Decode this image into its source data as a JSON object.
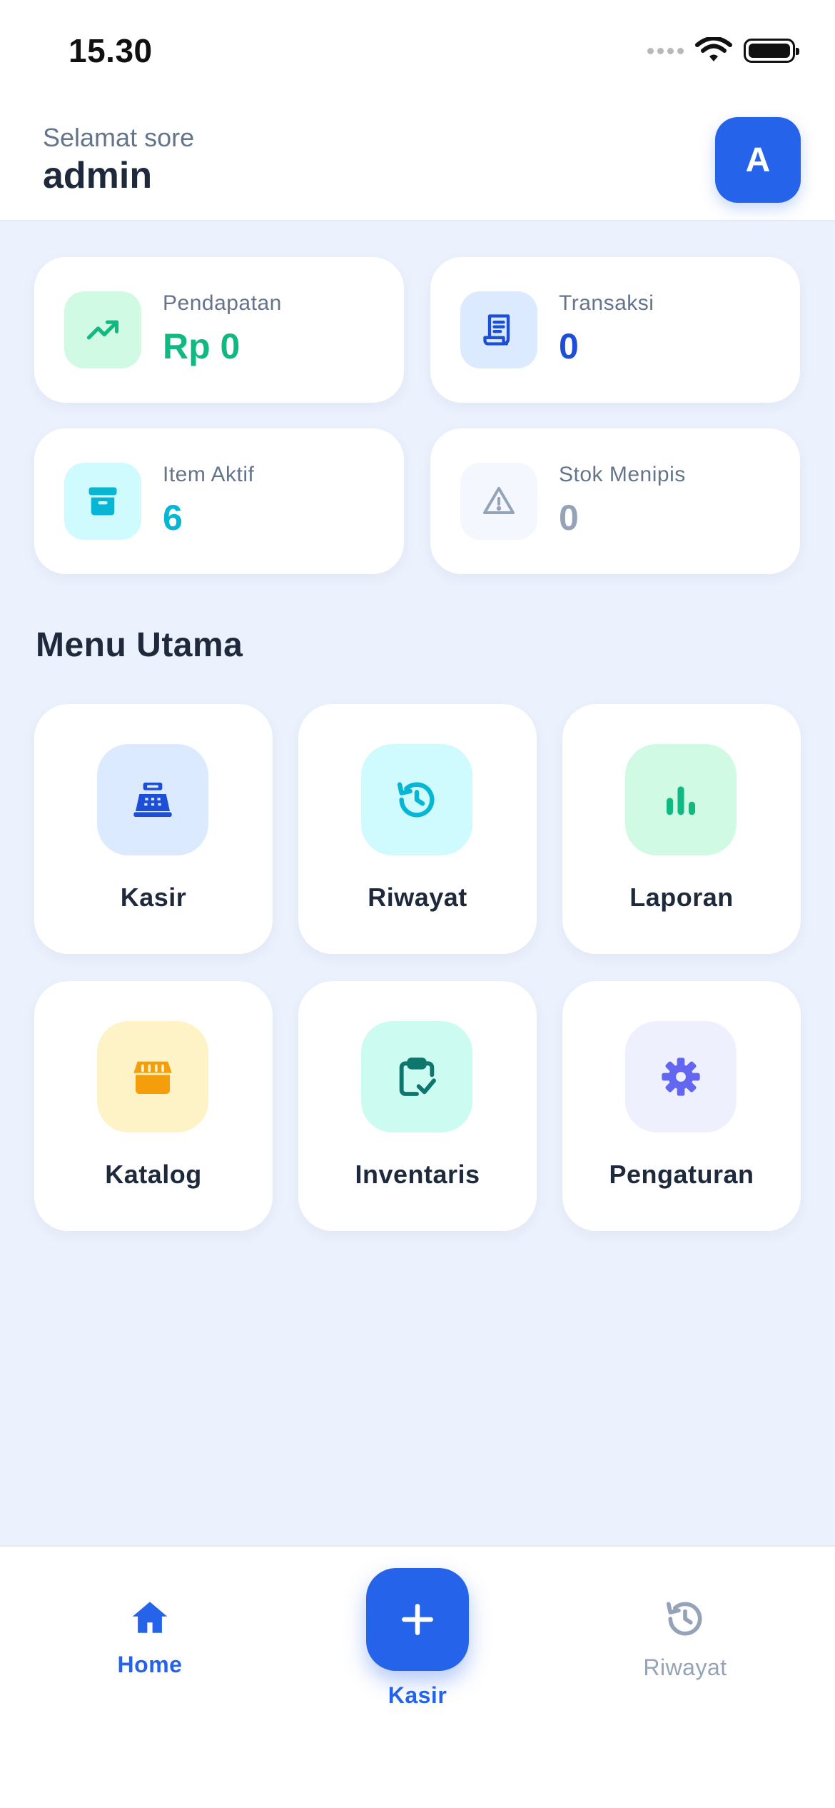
{
  "status_bar": {
    "time": "15.30",
    "icons": [
      "signal-icon",
      "wifi-icon",
      "battery-icon"
    ]
  },
  "header": {
    "greeting": "Selamat sore",
    "username": "admin",
    "avatar_initial": "A"
  },
  "stats": [
    {
      "label": "Pendapatan",
      "value": "Rp 0",
      "icon": "trending-up-icon",
      "color": "#10b981",
      "bg": "#d1fae5"
    },
    {
      "label": "Transaksi",
      "value": "0",
      "icon": "receipt-icon",
      "color": "#1d4ed8",
      "bg": "#dbeafe"
    },
    {
      "label": "Item Aktif",
      "value": "6",
      "icon": "archive-box-icon",
      "color": "#06b6d4",
      "bg": "#cffafe"
    },
    {
      "label": "Stok Menipis",
      "value": "0",
      "icon": "warning-icon",
      "color": "#94a3b8",
      "bg": "#f4f7fd"
    }
  ],
  "menu": {
    "title": "Menu Utama",
    "items": [
      {
        "label": "Kasir",
        "icon": "cash-register-icon",
        "color": "#1d4ed8",
        "bg": "#dbeafe"
      },
      {
        "label": "Riwayat",
        "icon": "history-icon",
        "color": "#06b6d4",
        "bg": "#cffafe"
      },
      {
        "label": "Laporan",
        "icon": "bar-chart-icon",
        "color": "#10b981",
        "bg": "#d1fae5"
      },
      {
        "label": "Katalog",
        "icon": "store-icon",
        "color": "#f59e0b",
        "bg": "#fef3c7"
      },
      {
        "label": "Inventaris",
        "icon": "clipboard-check-icon",
        "color": "#0f766e",
        "bg": "#ccfbf1"
      },
      {
        "label": "Pengaturan",
        "icon": "gear-icon",
        "color": "#6366f1",
        "bg": "#eef0fd"
      }
    ]
  },
  "bottom_nav": {
    "home_label": "Home",
    "center_label": "Kasir",
    "history_label": "Riwayat",
    "active_color": "#2563eb",
    "inactive_color": "#94a3b8"
  }
}
